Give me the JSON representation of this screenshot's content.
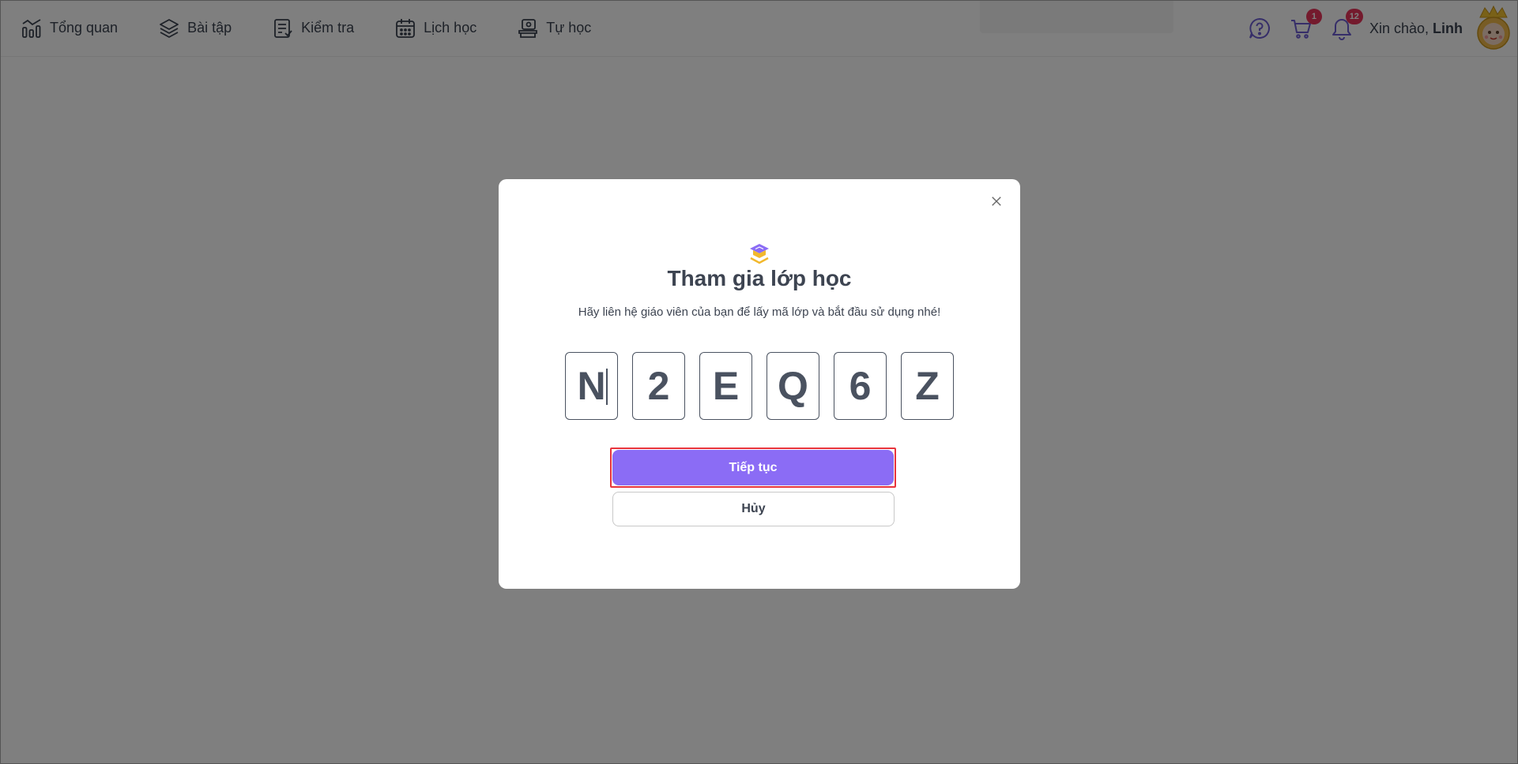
{
  "nav": {
    "items": [
      {
        "label": "Tổng quan",
        "icon": "chart-bars-icon"
      },
      {
        "label": "Bài tập",
        "icon": "layers-icon"
      },
      {
        "label": "Kiểm tra",
        "icon": "checklist-icon"
      },
      {
        "label": "Lịch học",
        "icon": "calendar-icon"
      },
      {
        "label": "Tự học",
        "icon": "self-study-icon"
      }
    ]
  },
  "header": {
    "cart_badge": "1",
    "notification_badge": "12",
    "greeting_prefix": "Xin chào, ",
    "user_name": "Linh"
  },
  "modal": {
    "title": "Tham gia lớp học",
    "subtitle": "Hãy liên hệ giáo viên của bạn để lấy mã lớp và bắt đầu sử dụng nhé!",
    "code": [
      "N",
      "2",
      "E",
      "Q",
      "6",
      "Z"
    ],
    "continue_label": "Tiếp tục",
    "cancel_label": "Hủy"
  },
  "colors": {
    "primary": "#8b6cf5",
    "badge": "#e8345a",
    "focus_ring": "#e8343c",
    "text": "#3d4451"
  }
}
